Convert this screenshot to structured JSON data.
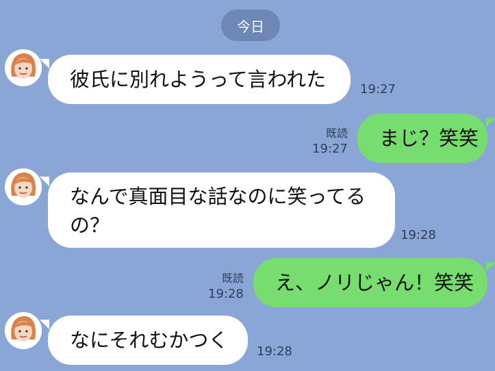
{
  "date_label": "今日",
  "messages": [
    {
      "side": "left",
      "text": "彼氏に別れようって言われた",
      "time": "19:27"
    },
    {
      "side": "right",
      "text": "まじ？笑笑",
      "time": "19:27",
      "read": "既読"
    },
    {
      "side": "left",
      "line1": "なんで真面目な話なのに笑ってる",
      "line2": "の？",
      "time": "19:28"
    },
    {
      "side": "right",
      "text": "え、ノリじゃん！笑笑",
      "time": "19:28",
      "read": "既読"
    },
    {
      "side": "left",
      "text": "なにそれむかつく",
      "time": "19:28"
    }
  ]
}
